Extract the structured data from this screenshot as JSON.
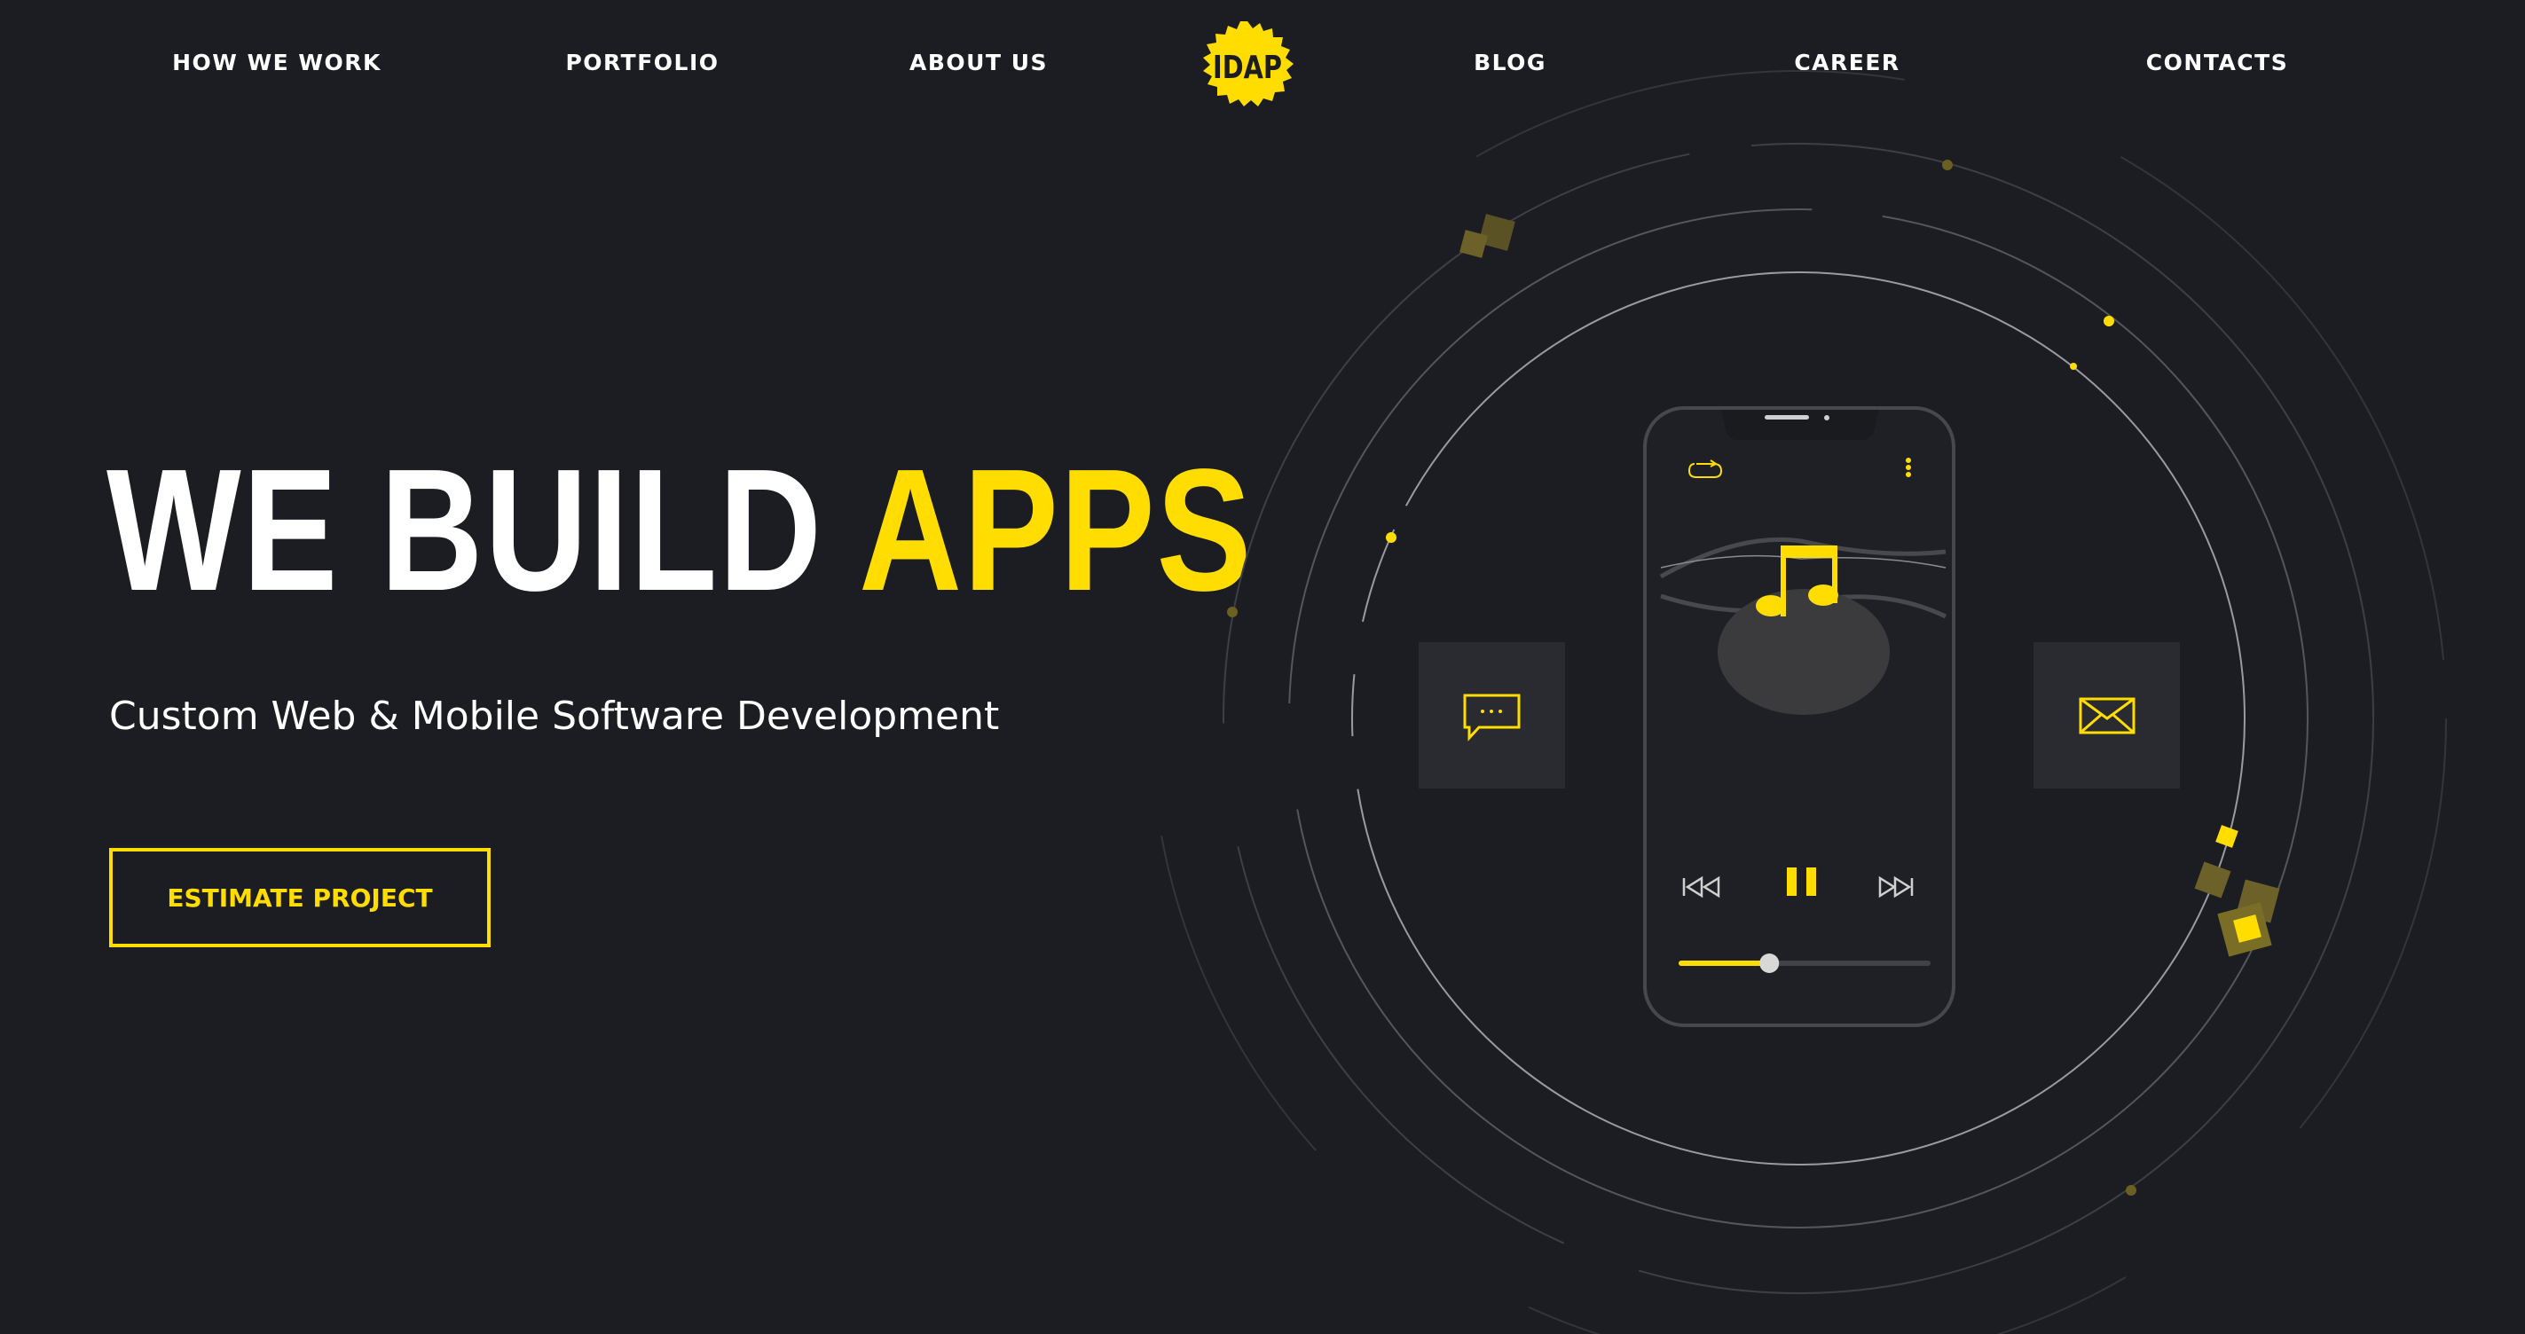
{
  "nav": {
    "items": [
      {
        "label": "HOW WE WORK"
      },
      {
        "label": "PORTFOLIO"
      },
      {
        "label": "ABOUT US"
      },
      {
        "label": "BLOG"
      },
      {
        "label": "CAREER"
      },
      {
        "label": "CONTACTS"
      }
    ],
    "logo_text": "IDAP"
  },
  "hero": {
    "title_white": "WE BUILD",
    "title_accent": "APPS",
    "subtitle": "Custom Web & Mobile Software Development",
    "cta_label": "ESTIMATE PROJECT"
  },
  "player": {
    "progress": 0.36,
    "state": "playing",
    "icons": [
      "repeat-icon",
      "more-vertical-icon",
      "music-note-icon",
      "previous-icon",
      "pause-icon",
      "next-icon"
    ]
  },
  "side_icons": [
    "chat-bubble-icon",
    "mail-icon"
  ],
  "colors": {
    "accent": "#ffdd00",
    "background": "#1c1d22",
    "card": "#2a2b30"
  }
}
